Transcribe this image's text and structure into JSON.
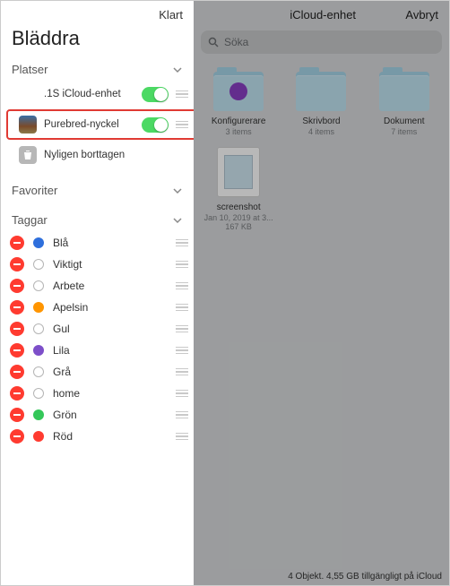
{
  "sidebar": {
    "done_label": "Klart",
    "title": "Bläddra",
    "sections": {
      "platser": "Platser",
      "favoriter": "Favoriter",
      "taggar": "Taggar"
    },
    "locations": [
      {
        "name": ".1S iCloud-enhet",
        "toggle": true,
        "icon": "none"
      },
      {
        "name": "Purebred-nyckel",
        "toggle": true,
        "icon": "purebred",
        "highlighted": true
      },
      {
        "name": "Nyligen borttagen",
        "toggle": false,
        "icon": "trash"
      }
    ],
    "tags": [
      {
        "name": "Blå",
        "color": "#2e6fdc",
        "hollow": false
      },
      {
        "name": "Viktigt",
        "color": "",
        "hollow": true
      },
      {
        "name": "Arbete",
        "color": "",
        "hollow": true
      },
      {
        "name": "Apelsin",
        "color": "#ff9500",
        "hollow": false
      },
      {
        "name": "Gul",
        "color": "",
        "hollow": true
      },
      {
        "name": "Lila",
        "color": "#7d4fc9",
        "hollow": false
      },
      {
        "name": "Grå",
        "color": "",
        "hollow": true
      },
      {
        "name": "home",
        "color": "",
        "hollow": true
      },
      {
        "name": "Grön",
        "color": "#34c759",
        "hollow": false
      },
      {
        "name": "Röd",
        "color": "#ff3b30",
        "hollow": false
      }
    ]
  },
  "main": {
    "title": "iCloud-enhet",
    "cancel_label": "Avbryt",
    "search_placeholder": "Söka",
    "items": [
      {
        "kind": "folder",
        "name": "Konfigurerare",
        "sub": "3 items",
        "badge_color": "#8a3fc4"
      },
      {
        "kind": "folder",
        "name": "Skrivbord",
        "sub": "4 items",
        "badge_color": ""
      },
      {
        "kind": "folder",
        "name": "Dokument",
        "sub": "7 items",
        "badge_color": ""
      },
      {
        "kind": "file",
        "name": "screenshot",
        "sub": "Jan 10, 2019 at 3...",
        "sub2": "167 KB"
      }
    ],
    "footer": "4 Objekt. 4,55 GB tillgängligt på iCloud"
  }
}
